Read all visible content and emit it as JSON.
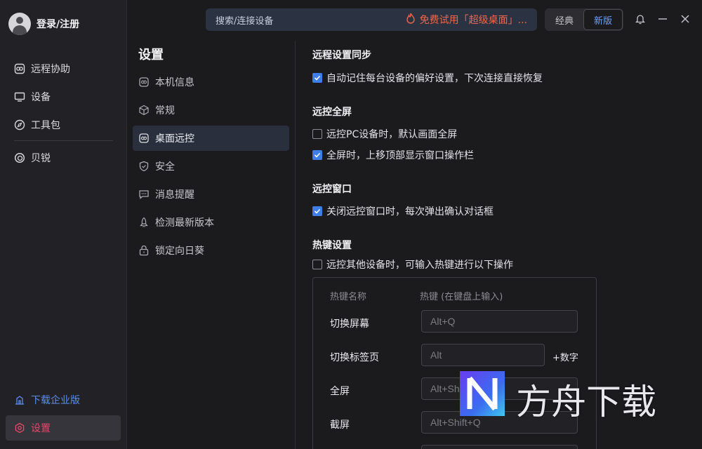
{
  "user": {
    "label": "登录/注册"
  },
  "nav": {
    "items": [
      {
        "label": "远程协助",
        "icon": "remote-assist-icon"
      },
      {
        "label": "设备",
        "icon": "monitor-icon"
      },
      {
        "label": "工具包",
        "icon": "compass-icon"
      }
    ],
    "extra": {
      "label": "贝锐",
      "icon": "beirui-logo-icon"
    }
  },
  "bottom": {
    "download": "下载企业版",
    "settings": "设置"
  },
  "topbar": {
    "search_placeholder": "搜索/连接设备",
    "promo": "免费试用「超级桌面」...",
    "classic": "经典",
    "new": "新版"
  },
  "settings": {
    "title": "设置",
    "menu": [
      {
        "label": "本机信息",
        "active": false
      },
      {
        "label": "常规",
        "active": false
      },
      {
        "label": "桌面远控",
        "active": true
      },
      {
        "label": "安全",
        "active": false
      },
      {
        "label": "消息提醒",
        "active": false
      },
      {
        "label": "检测最新版本",
        "active": false
      },
      {
        "label": "锁定向日葵",
        "active": false
      }
    ]
  },
  "content": {
    "sync": {
      "title": "远程设置同步",
      "opt1": {
        "label": "自动记住每台设备的偏好设置，下次连接直接恢复",
        "checked": true
      }
    },
    "fullscreen": {
      "title": "远控全屏",
      "opt1": {
        "label": "远控PC设备时，默认画面全屏",
        "checked": false
      },
      "opt2": {
        "label": "全屏时，上移顶部显示窗口操作栏",
        "checked": true
      }
    },
    "window": {
      "title": "远控窗口",
      "opt1": {
        "label": "关闭远控窗口时，每次弹出确认对话框",
        "checked": true
      }
    },
    "hotkey": {
      "title": "热键设置",
      "opt1": {
        "label": "远控其他设备时，可输入热键进行以下操作",
        "checked": false
      },
      "head_name": "热键名称",
      "head_key": "热键 (在键盘上输入)",
      "rows": [
        {
          "name": "切换屏幕",
          "key": "Alt+Q",
          "suffix": ""
        },
        {
          "name": "切换标签页",
          "key": "Alt",
          "suffix": "+数字"
        },
        {
          "name": "全屏",
          "key": "Alt+Shift+F",
          "suffix": ""
        },
        {
          "name": "截屏",
          "key": "Alt+Shift+Q",
          "suffix": ""
        }
      ]
    }
  },
  "watermark": {
    "text": "方舟下载"
  },
  "colors": {
    "accent": "#3f7ee8",
    "danger": "#e8476a",
    "promo": "#f0664a"
  }
}
